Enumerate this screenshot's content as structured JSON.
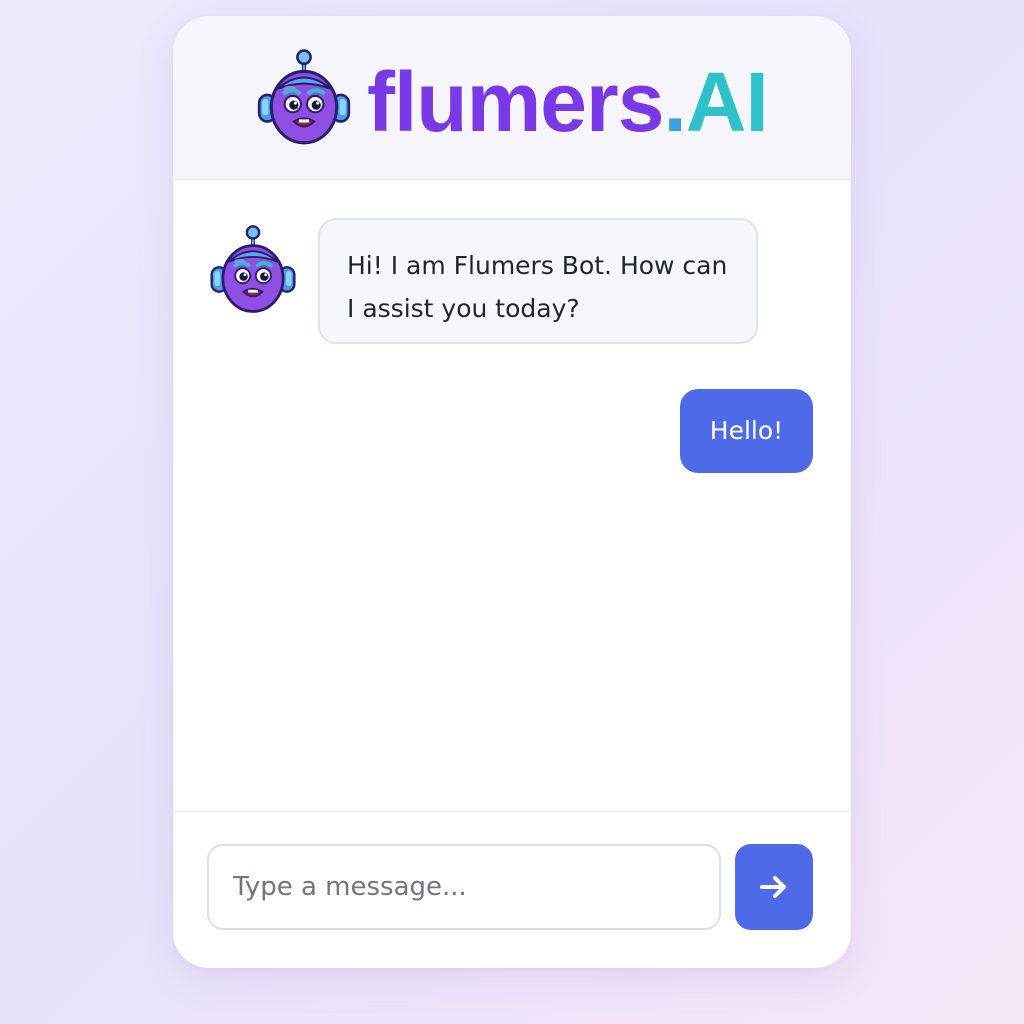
{
  "header": {
    "logo_icon": "robot-mascot-icon",
    "brand_main": "flumers",
    "brand_dot": ".",
    "brand_ai": "AI"
  },
  "conversation": {
    "messages": [
      {
        "sender": "bot",
        "avatar_icon": "robot-mascot-icon",
        "text": "Hi! I am Flumers Bot. How can I assist you today?"
      },
      {
        "sender": "user",
        "text": "Hello!"
      }
    ]
  },
  "composer": {
    "placeholder": "Type a message...",
    "value": "",
    "send_icon": "arrow-right-icon"
  },
  "colors": {
    "accent": "#4f6ae8",
    "brand_purple": "#7a39e6",
    "brand_teal": "#2fc1c9"
  }
}
